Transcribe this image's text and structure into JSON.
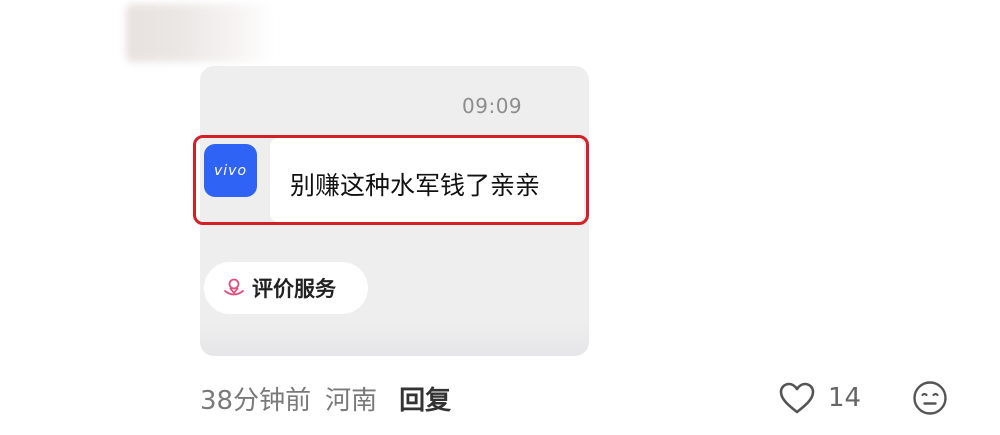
{
  "screenshot": {
    "time": "09:09",
    "sender_logo": "vivo",
    "message": "别赚这种水军钱了亲亲",
    "rate_service_label": "评价服务",
    "rate_icon": "flower-hand-icon"
  },
  "comment_meta": {
    "time_ago": "38分钟前",
    "location": "河南",
    "reply_label": "回复",
    "like_count": "14",
    "like_icon": "heart-outline-icon",
    "emoji_icon": "neutral-face-icon"
  },
  "colors": {
    "highlight": "#d32026",
    "vivo_blue": "#2e63f5",
    "screenshot_bg": "#eeeeef"
  }
}
